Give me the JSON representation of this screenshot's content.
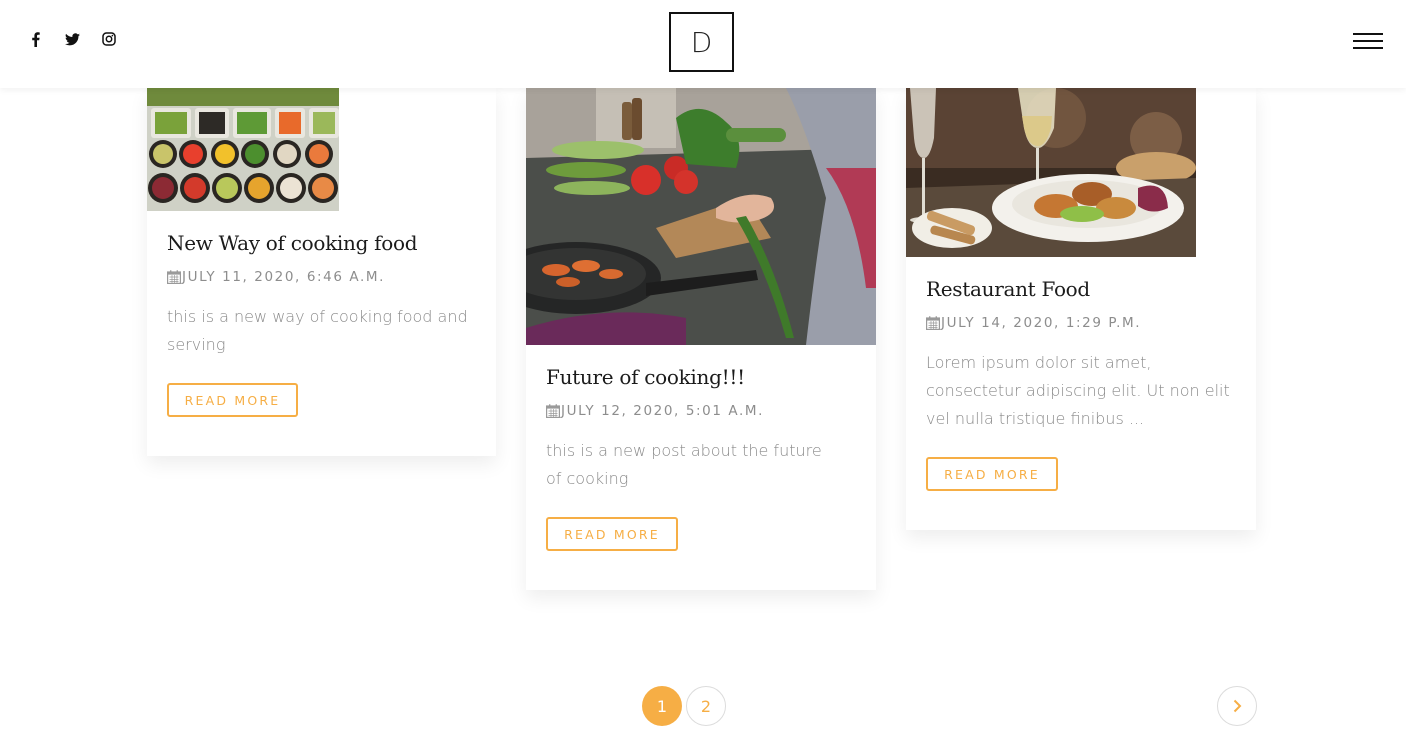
{
  "header": {
    "logo": "D",
    "social": [
      "facebook-icon",
      "twitter-icon",
      "instagram-icon"
    ],
    "menu_icon": "hamburger-menu-icon"
  },
  "theme": {
    "accent": "#f6ae45",
    "text_dark": "#1b1b1b",
    "text_muted": "#8a8a8a"
  },
  "posts": [
    {
      "title": "New Way of cooking food",
      "date": "JULY 11, 2020, 6:46 A.M.",
      "excerpt": "this is a new way of cooking food and serving",
      "button": "READ MORE",
      "image": "vegetable-bowls-photo"
    },
    {
      "title": "Future of cooking!!!",
      "date": "JULY 12, 2020, 5:01 A.M.",
      "excerpt": "this is a new post about the future of cooking",
      "button": "READ MORE",
      "image": "kitchen-cutting-vegetables-photo"
    },
    {
      "title": "Restaurant Food",
      "date": "JULY 14, 2020, 1:29 P.M.",
      "excerpt": "Lorem ipsum dolor sit amet, consectetur adipiscing elit. Ut non elit vel nulla tristique finibus ...",
      "button": "READ MORE",
      "image": "restaurant-plate-photo"
    }
  ],
  "pagination": {
    "pages": [
      "1",
      "2"
    ],
    "current": "1",
    "next_icon": "chevron-right-icon"
  }
}
